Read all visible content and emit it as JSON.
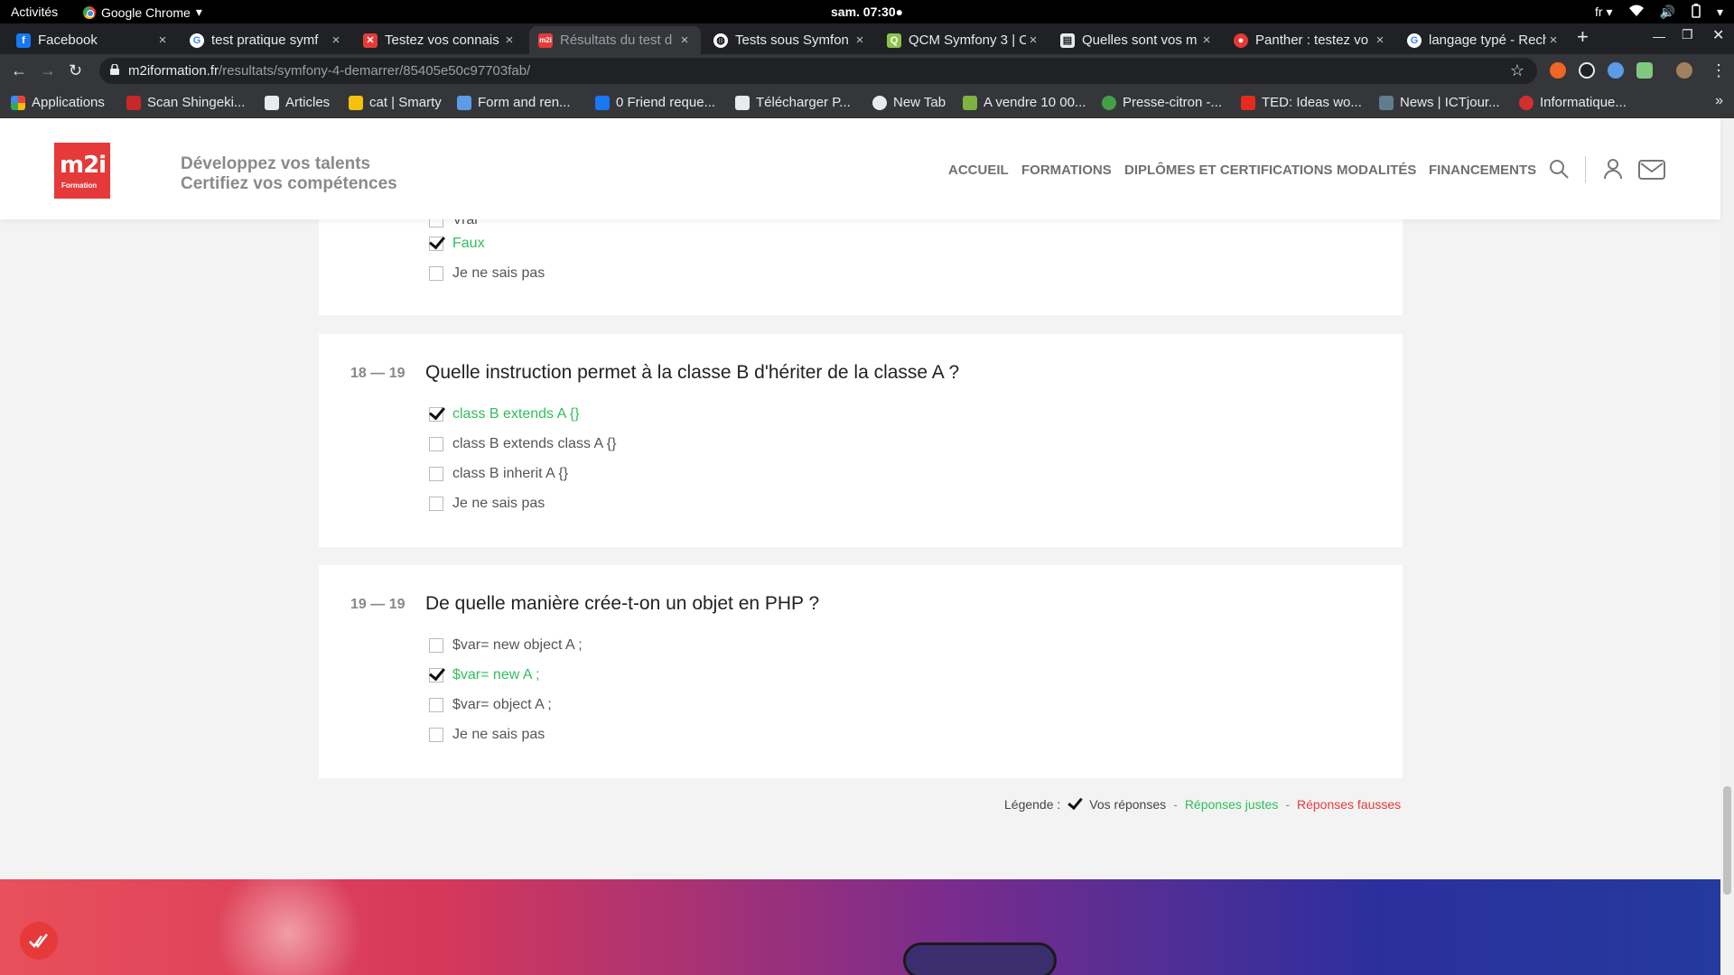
{
  "os_bar": {
    "activities": "Activités",
    "app": "Google Chrome",
    "clock": "sam. 07:30●",
    "lang": "fr"
  },
  "tabs": [
    {
      "label": "Facebook",
      "icon": "facebook-icon"
    },
    {
      "label": "test pratique symf",
      "icon": "google-icon"
    },
    {
      "label": "Testez vos connais",
      "icon": "bookmark-icon"
    },
    {
      "label": "Résultats du test d",
      "icon": "m2i-icon"
    },
    {
      "label": "Tests sous Symfon",
      "icon": "globe-icon"
    },
    {
      "label": "QCM Symfony 3 | C",
      "icon": "qcm-icon"
    },
    {
      "label": "Quelles sont vos m",
      "icon": "page-icon"
    },
    {
      "label": "Panther : testez vo",
      "icon": "panther-icon"
    },
    {
      "label": "langage typé - Rech",
      "icon": "google-icon"
    }
  ],
  "address_bar": {
    "domain": "m2iformation.fr",
    "path": "/resultats/symfony-4-demarrer/85405e50c97703fab/"
  },
  "bookmarks": [
    {
      "label": "Applications"
    },
    {
      "label": "Scan Shingeki..."
    },
    {
      "label": "Articles"
    },
    {
      "label": "cat | Smarty"
    },
    {
      "label": "Form and ren..."
    },
    {
      "label": "0 Friend reque..."
    },
    {
      "label": "Télécharger P..."
    },
    {
      "label": "New Tab"
    },
    {
      "label": "A vendre 10 00..."
    },
    {
      "label": "Presse-citron -..."
    },
    {
      "label": "TED: Ideas wo..."
    },
    {
      "label": "News | ICTjour..."
    },
    {
      "label": "Informatique..."
    }
  ],
  "header": {
    "logo_text": "m2i",
    "logo_sub": "Formation",
    "tagline_1": "Développez vos talents",
    "tagline_2": "Certifiez vos compétences",
    "nav": [
      "ACCUEIL",
      "FORMATIONS",
      "DIPLÔMES ET CERTIFICATIONS",
      "MODALITÉS",
      "FINANCEMENTS"
    ]
  },
  "prev_question_tail": {
    "options": [
      {
        "text": "Vrai",
        "checked": false,
        "correct": false
      },
      {
        "text": "Faux",
        "checked": true,
        "correct": true
      },
      {
        "text": "Je ne sais pas",
        "checked": false,
        "correct": false
      }
    ]
  },
  "questions": [
    {
      "number": "18 — 19",
      "text": "Quelle instruction permet à la classe B d'hériter de la classe A ?",
      "options": [
        {
          "text": "class B extends A {}",
          "checked": true,
          "correct": true
        },
        {
          "text": "class B extends class A {}",
          "checked": false,
          "correct": false
        },
        {
          "text": "class B inherit A {}",
          "checked": false,
          "correct": false
        },
        {
          "text": "Je ne sais pas",
          "checked": false,
          "correct": false
        }
      ]
    },
    {
      "number": "19 — 19",
      "text": "De quelle manière crée-t-on un objet en PHP ?",
      "options": [
        {
          "text": "$var= new object A ;",
          "checked": false,
          "correct": false
        },
        {
          "text": "$var= new A ;",
          "checked": true,
          "correct": true
        },
        {
          "text": "$var= object A ;",
          "checked": false,
          "correct": false
        },
        {
          "text": "Je ne sais pas",
          "checked": false,
          "correct": false
        }
      ]
    }
  ],
  "legend": {
    "label": "Légende :",
    "yours": "Vos réponses",
    "good": "Réponses justes",
    "bad": "Réponses fausses",
    "sep": "-"
  },
  "colors": {
    "accent": "#e63a3a",
    "correct": "#2fbf5b"
  }
}
